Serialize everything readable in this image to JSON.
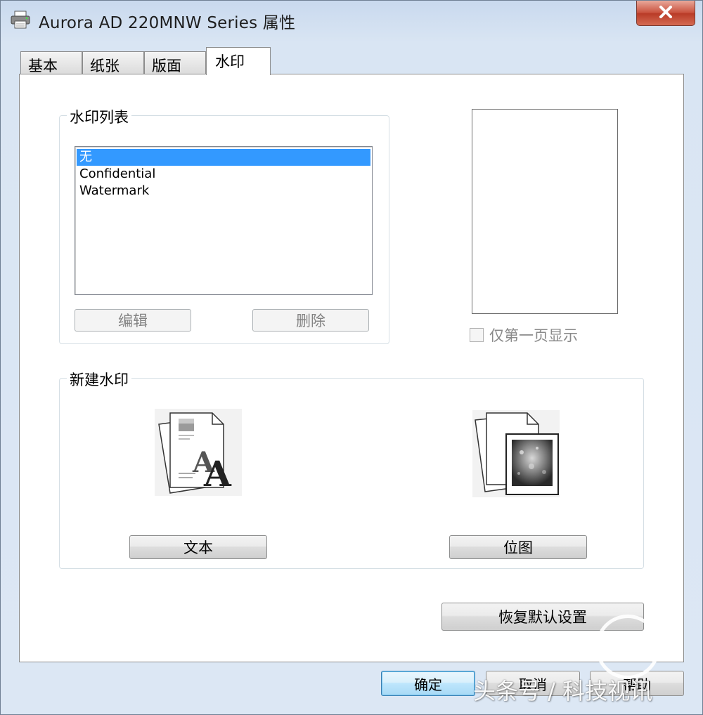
{
  "window": {
    "title": "Aurora AD 220MNW Series 属性",
    "icon": "printer-icon",
    "close_icon": "close-icon"
  },
  "tabs": [
    {
      "label": "基本",
      "active": false
    },
    {
      "label": "纸张",
      "active": false
    },
    {
      "label": "版面",
      "active": false
    },
    {
      "label": "水印",
      "active": true
    }
  ],
  "watermark_list": {
    "title": "水印列表",
    "items": [
      {
        "label": "无",
        "selected": true
      },
      {
        "label": "Confidential",
        "selected": false
      },
      {
        "label": "Watermark",
        "selected": false
      }
    ],
    "edit_label": "编辑",
    "delete_label": "删除"
  },
  "preview": {
    "first_page_only_label": "仅第一页显示",
    "first_page_only_checked": false
  },
  "new_watermark": {
    "title": "新建水印",
    "text_label": "文本",
    "bitmap_label": "位图",
    "text_icon": "text-watermark-icon",
    "bitmap_icon": "bitmap-watermark-icon"
  },
  "restore_defaults_label": "恢复默认设置",
  "footer": {
    "ok_label": "确定",
    "cancel_label": "取消",
    "help_label": "帮助"
  },
  "overlay_watermark": "头条号 / 科技视讯",
  "colors": {
    "selection": "#3399ff",
    "close_button": "#c9503c"
  }
}
